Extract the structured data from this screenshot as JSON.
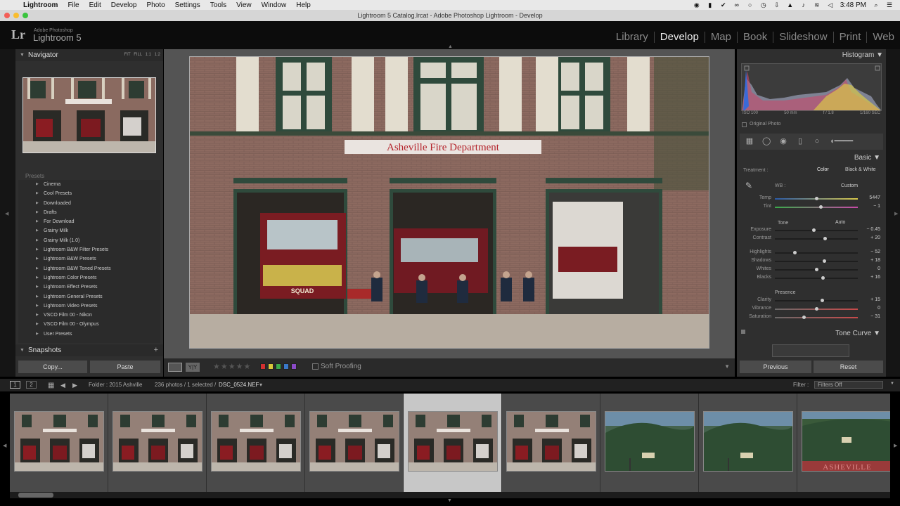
{
  "menubar": {
    "items": [
      "Lightroom",
      "File",
      "Edit",
      "Develop",
      "Photo",
      "Settings",
      "Tools",
      "View",
      "Window",
      "Help"
    ],
    "time": "3:48 PM"
  },
  "window_title": "Lightroom 5 Catalog.lrcat - Adobe Photoshop Lightroom - Develop",
  "identity": {
    "logo": "Lr",
    "brand_small": "Adobe Photoshop",
    "brand_large": "Lightroom 5"
  },
  "modules": [
    "Library",
    "Develop",
    "Map",
    "Book",
    "Slideshow",
    "Print",
    "Web"
  ],
  "active_module": "Develop",
  "left": {
    "navigator_title": "Navigator",
    "zoom_options": "FIT FILL 1:1 1:2",
    "presets_title": "Presets",
    "presets": [
      "Cinema",
      "Cool Presets",
      "Downloaded",
      "Drafts",
      "For Download",
      "Grainy Milk",
      "Grainy Milk (1.0)",
      "Lightroom B&W Filter Presets",
      "Lightroom B&W Presets",
      "Lightroom B&W Toned Presets",
      "Lightroom Color Presets",
      "Lightroom Effect Presets",
      "Lightroom General Presets",
      "Lightroom Video Presets",
      "VSCO Film 00 - Nikon",
      "VSCO Film 00 - Olympus",
      "User Presets"
    ],
    "snapshots_title": "Snapshots",
    "copy_label": "Copy...",
    "paste_label": "Paste"
  },
  "photo": {
    "sign_text": "Asheville Fire Department",
    "truck_text": "SQUAD"
  },
  "toolbar": {
    "yy_label": "Y|Y",
    "stars": "★★★★★",
    "color_labels": [
      "#d33030",
      "#d8c83a",
      "#3aa94a",
      "#3a78c8",
      "#8a4ac8"
    ],
    "soft_proofing": "Soft Proofing"
  },
  "right": {
    "histogram_title": "Histogram",
    "exif": [
      "ISO 100",
      "50 mm",
      "f / 1.8",
      "1/160 SEC"
    ],
    "original_photo": "Original Photo",
    "basic_title": "Basic",
    "treatment_label": "Treatment :",
    "treatment_color": "Color",
    "treatment_bw": "Black & White",
    "wb_label": "WB :",
    "wb_value": "Custom",
    "tone_label": "Tone",
    "auto_label": "Auto",
    "presence_label": "Presence",
    "sliders": [
      {
        "label": "Temp",
        "value": "5447",
        "level": 0.5
      },
      {
        "label": "Tint",
        "value": "− 1",
        "level": 0.55
      },
      {
        "label": "Exposure",
        "value": "− 0.45",
        "level": 0.47
      },
      {
        "label": "Contrast",
        "value": "+ 20",
        "level": 0.6
      },
      {
        "label": "Highlights",
        "value": "− 52",
        "level": 0.24
      },
      {
        "label": "Shadows",
        "value": "+ 18",
        "level": 0.59
      },
      {
        "label": "Whites",
        "value": "0",
        "level": 0.5
      },
      {
        "label": "Blacks",
        "value": "+ 16",
        "level": 0.58
      },
      {
        "label": "Clarity",
        "value": "+ 15",
        "level": 0.57
      },
      {
        "label": "Vibrance",
        "value": "0",
        "level": 0.5
      },
      {
        "label": "Saturation",
        "value": "− 31",
        "level": 0.35
      }
    ],
    "tone_curve_title": "Tone Curve",
    "previous_label": "Previous",
    "reset_label": "Reset"
  },
  "filmstrip": {
    "page1": "1",
    "page2": "2",
    "folder": "Folder : 2015 Ashville",
    "count": "236 photos / 1 selected /",
    "filename": "DSC_0524.NEF",
    "filter_label": "Filter :",
    "filter_value": "Filters Off",
    "selected_index": 4,
    "thumbs": [
      "firehouse",
      "firehouse",
      "firehouse",
      "firehouse",
      "firehouse",
      "firehouse",
      "hillside",
      "hillside",
      "asheville-sign"
    ]
  }
}
